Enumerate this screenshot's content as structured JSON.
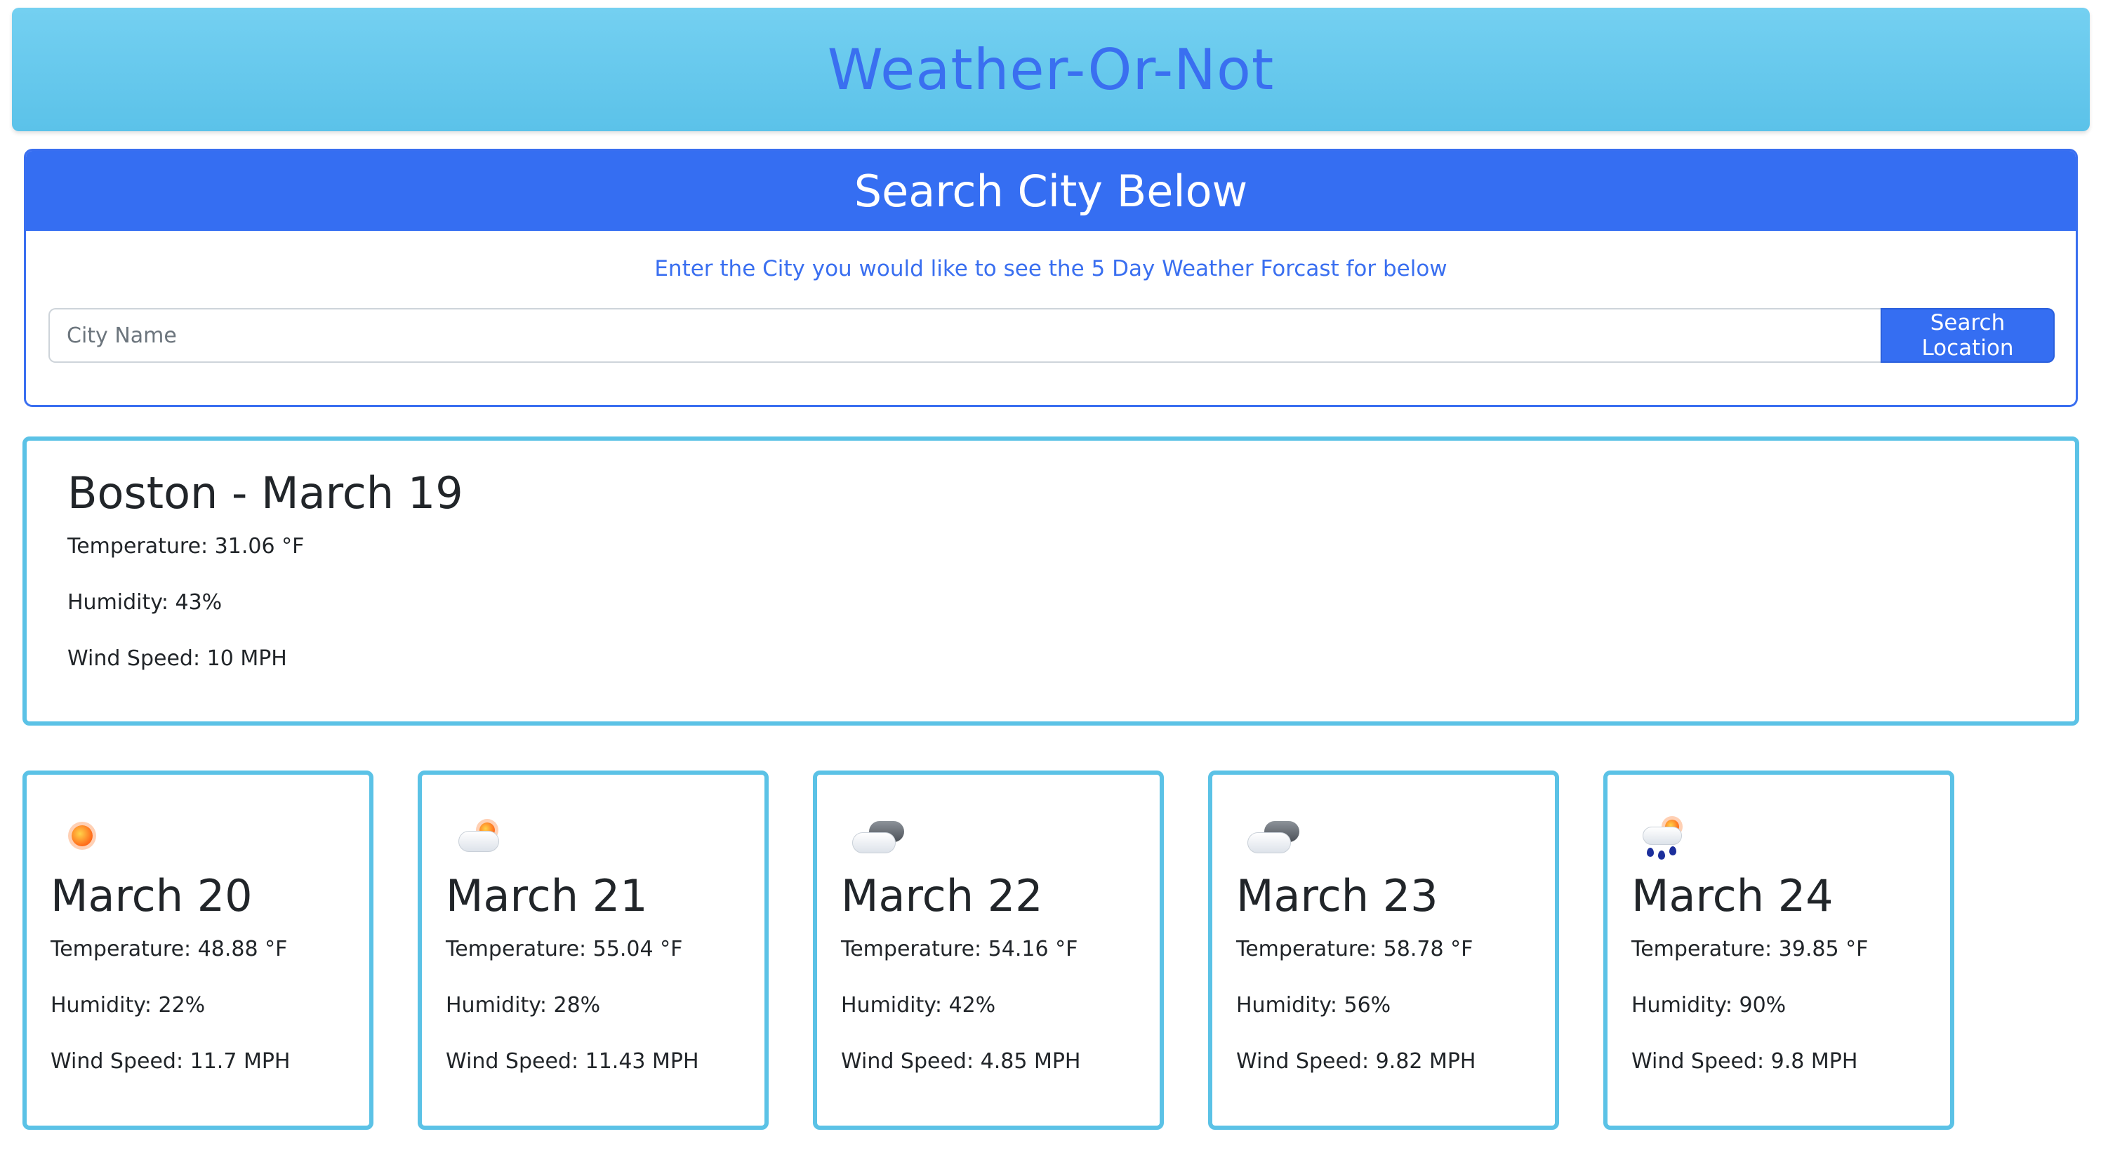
{
  "header": {
    "title": "Weather-Or-Not"
  },
  "search": {
    "title": "Search City Below",
    "instructions": "Enter the City you would like to see the 5 Day Weather Forcast for below",
    "placeholder": "City Name",
    "value": "",
    "button_label": "Search Location"
  },
  "current": {
    "title": "Boston - March 19",
    "temperature": "Temperature: 31.06 °F",
    "humidity": "Humidity: 43%",
    "wind": "Wind Speed: 10 MPH"
  },
  "forecast": [
    {
      "icon": "sunny-icon",
      "date": "March 20",
      "temperature": "Temperature: 48.88 °F",
      "humidity": "Humidity: 22%",
      "wind": "Wind Speed: 11.7 MPH"
    },
    {
      "icon": "partly-cloudy-icon",
      "date": "March 21",
      "temperature": "Temperature: 55.04 °F",
      "humidity": "Humidity: 28%",
      "wind": "Wind Speed: 11.43 MPH"
    },
    {
      "icon": "cloudy-icon",
      "date": "March 22",
      "temperature": "Temperature: 54.16 °F",
      "humidity": "Humidity: 42%",
      "wind": "Wind Speed: 4.85 MPH"
    },
    {
      "icon": "cloudy-icon",
      "date": "March 23",
      "temperature": "Temperature: 58.78 °F",
      "humidity": "Humidity: 56%",
      "wind": "Wind Speed: 9.82 MPH"
    },
    {
      "icon": "rain-icon",
      "date": "March 24",
      "temperature": "Temperature: 39.85 °F",
      "humidity": "Humidity: 90%",
      "wind": "Wind Speed: 9.8 MPH"
    }
  ],
  "colors": {
    "brand_blue": "#356ef2",
    "title_blue": "#3a6ff0",
    "card_border": "#5bc2e6",
    "header_bg": "#6fcdf0"
  }
}
